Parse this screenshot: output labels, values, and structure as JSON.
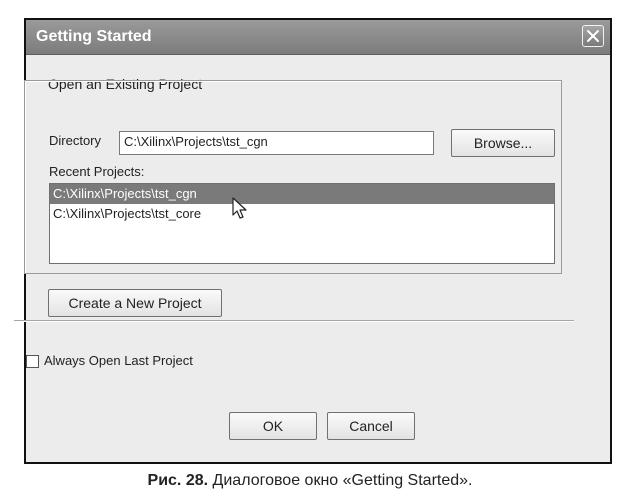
{
  "window": {
    "title": "Getting Started",
    "close_icon": "close-icon"
  },
  "open_existing": {
    "group_label": "Open an Existing Project",
    "directory_label": "Directory",
    "directory_value": "C:\\Xilinx\\Projects\\tst_cgn",
    "browse_label": "Browse...",
    "recent_label": "Recent Projects:",
    "recent_items": [
      "C:\\Xilinx\\Projects\\tst_cgn",
      "C:\\Xilinx\\Projects\\tst_core"
    ],
    "selected_index": 0
  },
  "create_new_label": "Create a New Project",
  "always_open_label": "Always Open Last Project",
  "always_open_checked": false,
  "buttons": {
    "ok": "OK",
    "cancel": "Cancel"
  },
  "caption": {
    "number": "Рис. 28.",
    "text": "Диалоговое окно «Getting Started»."
  }
}
